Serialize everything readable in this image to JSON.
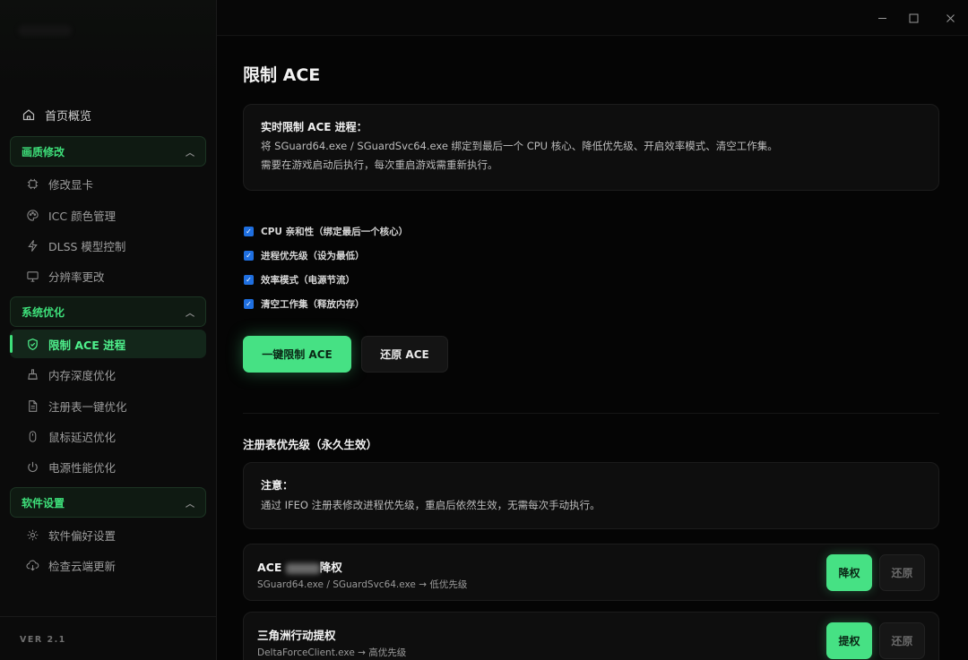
{
  "sidebar": {
    "home": "首页概览",
    "groups": [
      {
        "label": "画质修改",
        "items": [
          "修改显卡",
          "ICC 颜色管理",
          "DLSS 模型控制",
          "分辨率更改"
        ]
      },
      {
        "label": "系统优化",
        "items": [
          "限制 ACE 进程",
          "内存深度优化",
          "注册表一键优化",
          "鼠标延迟优化",
          "电源性能优化"
        ]
      },
      {
        "label": "软件设置",
        "items": [
          "软件偏好设置",
          "检查云端更新"
        ]
      }
    ],
    "active_item": "限制 ACE 进程",
    "version": "VER 2.1"
  },
  "window": {
    "minimize": "–",
    "maximize": "☐",
    "close": "✕"
  },
  "main": {
    "title": "限制 ACE",
    "info": {
      "title": "实时限制 ACE 进程：",
      "line1": "将 SGuard64.exe / SGuardSvc64.exe 绑定到最后一个 CPU 核心、降低优先级、开启效率模式、清空工作集。",
      "line2": "需要在游戏启动后执行，每次重启游戏需重新执行。"
    },
    "options": [
      {
        "label": "CPU 亲和性（绑定最后一个核心）",
        "checked": true
      },
      {
        "label": "进程优先级（设为最低）",
        "checked": true
      },
      {
        "label": "效率模式（电源节流）",
        "checked": true
      },
      {
        "label": "清空工作集（释放内存）",
        "checked": true
      }
    ],
    "primary_button": "一键限制 ACE",
    "secondary_button": "还原 ACE",
    "registry_section": {
      "title": "注册表优先级（永久生效）",
      "notice_title": "注意：",
      "notice_text": "通过 IFEO 注册表修改进程优先级，重启后依然生效，无需每次手动执行。",
      "rows": [
        {
          "title_prefix": "ACE",
          "title_suffix": "降权",
          "subtitle": "SGuard64.exe / SGuardSvc64.exe → 低优先级",
          "action": "降权",
          "restore": "还原"
        },
        {
          "title": "三角洲行动提权",
          "subtitle": "DeltaForceClient.exe → 高优先级",
          "action": "提权",
          "restore": "还原"
        }
      ]
    }
  },
  "colors": {
    "accent": "#46e184",
    "accent_text": "#3ee07a",
    "background": "#050505",
    "card": "#0e0e0e",
    "checkbox": "#1f6fe0"
  }
}
